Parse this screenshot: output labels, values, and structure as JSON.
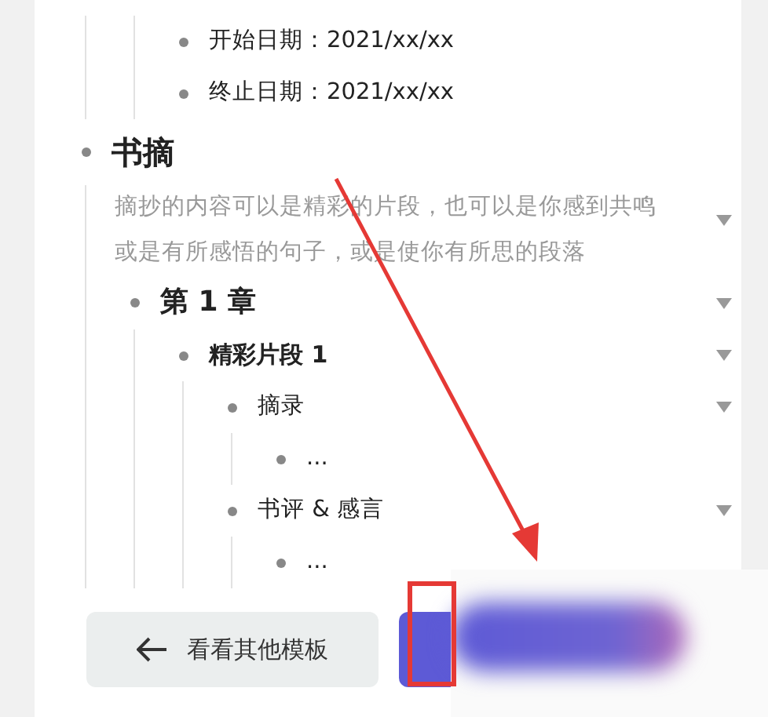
{
  "outline": [
    {
      "children": [
        {
          "children": [
            {
              "text": "开始日期：2021/xx/xx",
              "kind": "text",
              "collapsible": false
            },
            {
              "text": "终止日期：2021/xx/xx",
              "kind": "text",
              "collapsible": false
            }
          ]
        }
      ]
    },
    {
      "text": "书摘",
      "kind": "h1",
      "collapsible": false,
      "note": "摘抄的内容可以是精彩的片段，也可以是你感到共鸣或是有所感悟的句子，或是使你有所思的段落",
      "note_collapsible": true,
      "children": [
        {
          "text": "第 1 章",
          "kind": "h2",
          "collapsible": true,
          "children": [
            {
              "text": "精彩片段 1",
              "kind": "h3",
              "collapsible": true,
              "children": [
                {
                  "text": "摘录",
                  "kind": "text",
                  "collapsible": true,
                  "children": [
                    {
                      "text": "...",
                      "kind": "text",
                      "collapsible": false
                    }
                  ]
                },
                {
                  "text": "书评 & 感言",
                  "kind": "text",
                  "collapsible": true,
                  "children": [
                    {
                      "text": "...",
                      "kind": "text",
                      "collapsible": false
                    }
                  ]
                }
              ]
            }
          ]
        }
      ]
    }
  ],
  "buttons": [
    {
      "label": "看看其他模板",
      "kind": "back"
    },
    {
      "kind": "primary"
    }
  ]
}
